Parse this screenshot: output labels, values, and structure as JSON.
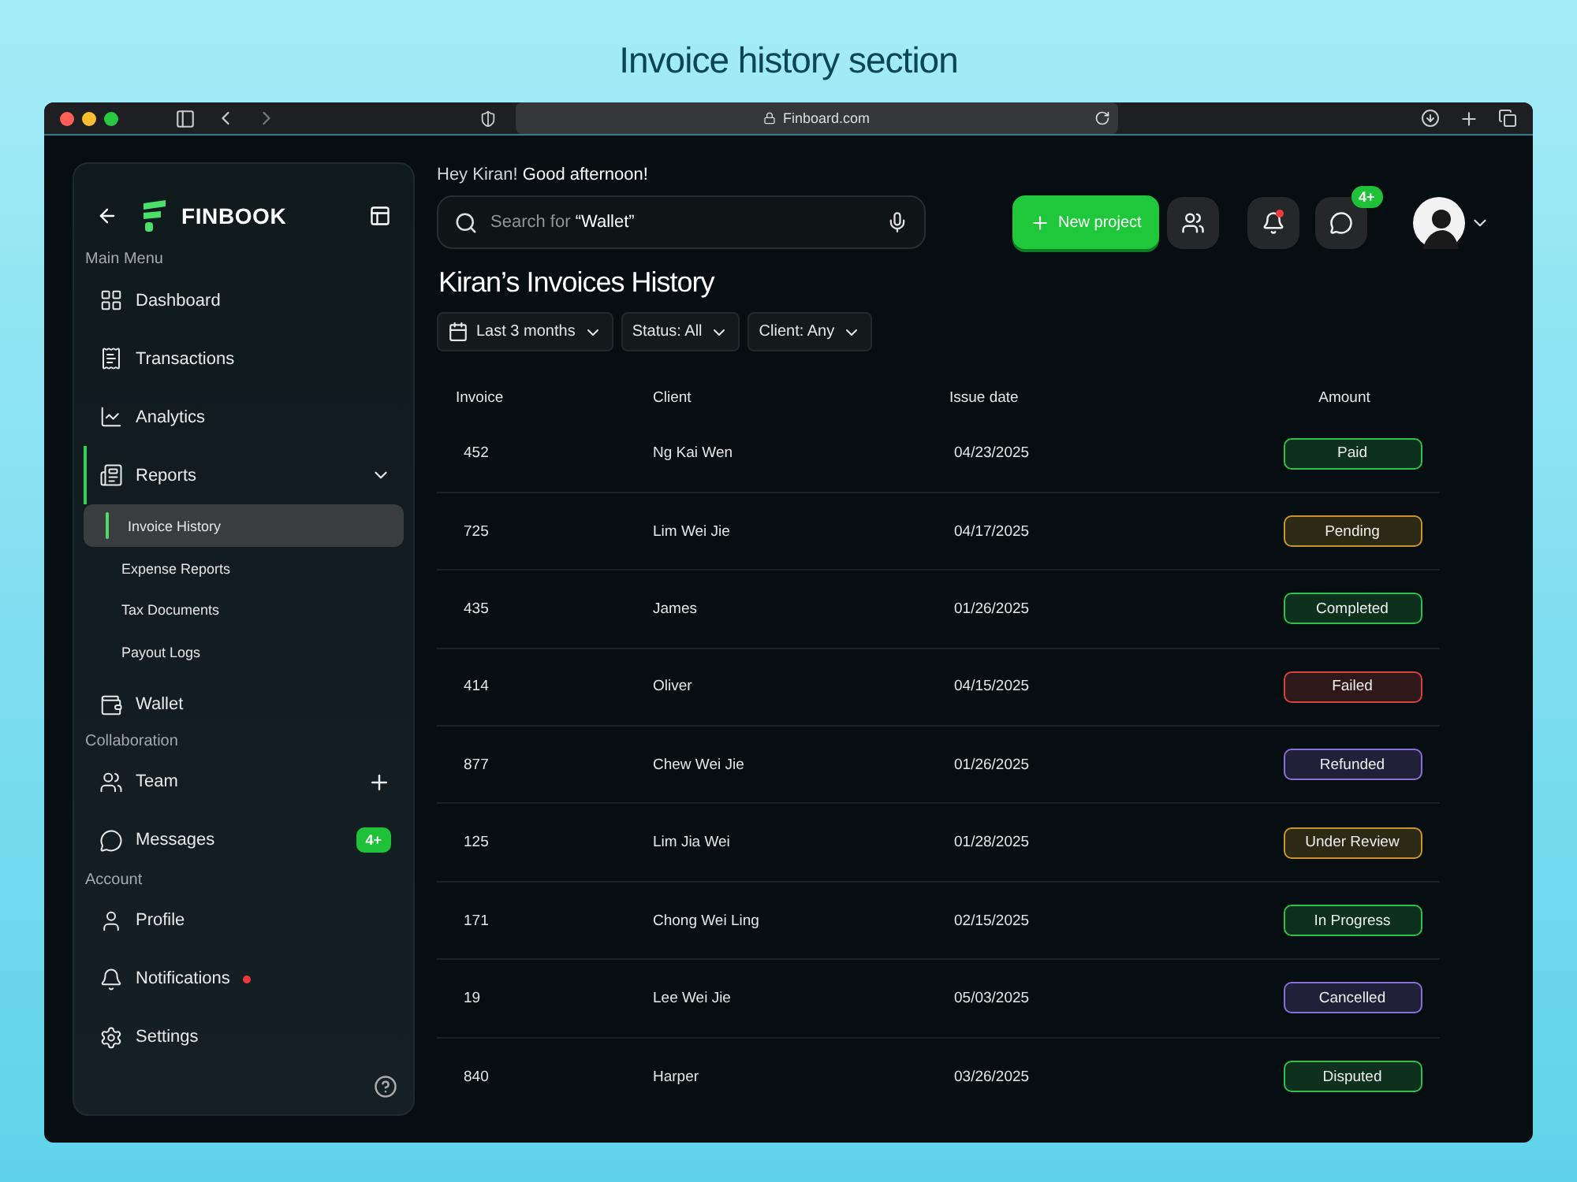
{
  "page_title": "Invoice history section",
  "browser": {
    "url": "Finboard.com"
  },
  "sidebar": {
    "logo": "FINBOOK",
    "sections": [
      {
        "label": "Main Menu",
        "items": [
          {
            "label": "Dashboard",
            "kind": "link",
            "selected": false
          },
          {
            "label": "Transactions",
            "kind": "link",
            "selected": false
          },
          {
            "label": "Analytics",
            "kind": "link",
            "selected": false
          },
          {
            "label": "Reports",
            "kind": "group",
            "selected": true,
            "expanded": true,
            "children": [
              {
                "label": "Invoice History",
                "selected": true
              },
              {
                "label": "Expense Reports",
                "selected": false
              },
              {
                "label": "Tax Documents",
                "selected": false
              },
              {
                "label": "Payout Logs",
                "selected": false
              }
            ]
          },
          {
            "label": "Wallet",
            "kind": "link",
            "selected": false
          }
        ]
      },
      {
        "label": "Collaboration",
        "items": [
          {
            "label": "Team",
            "kind": "add",
            "selected": false
          },
          {
            "label": "Messages",
            "kind": "badge",
            "badge": "4+",
            "selected": false
          }
        ]
      },
      {
        "label": "Account",
        "items": [
          {
            "label": "Profile",
            "kind": "link",
            "selected": false
          },
          {
            "label": "Notifications",
            "kind": "link",
            "alert": true,
            "selected": false
          },
          {
            "label": "Settings",
            "kind": "link",
            "selected": false
          }
        ]
      }
    ]
  },
  "greeting": {
    "prefix": "Hey Kiran!",
    "text": "Good afternoon!"
  },
  "search": {
    "placeholder": "Search for",
    "value": "“Wallet”"
  },
  "new_project": "New project",
  "notifications": {
    "alert": true
  },
  "messages_badge": "4+",
  "heading": "Kiran’s Invoices History",
  "filters": [
    {
      "label": "Last 3 months",
      "kind": "date"
    },
    {
      "label": "Status: All",
      "kind": "plain"
    },
    {
      "label": "Client: Any",
      "kind": "plain"
    }
  ],
  "table": {
    "columns": [
      "Invoice",
      "Client",
      "Issue date",
      "Amount"
    ],
    "rows": [
      {
        "invoice": "452",
        "client": "Ng Kai Wen",
        "date": "04/23/2025",
        "status": "Paid",
        "color": "#2fbf4f"
      },
      {
        "invoice": "725",
        "client": "Lim Wei Jie",
        "date": "04/17/2025",
        "status": "Pending",
        "color": "#c9962a"
      },
      {
        "invoice": "435",
        "client": "James",
        "date": "01/26/2025",
        "status": "Completed",
        "color": "#2fbf4f"
      },
      {
        "invoice": "414",
        "client": "Oliver",
        "date": "04/15/2025",
        "status": "Failed",
        "color": "#d8413f"
      },
      {
        "invoice": "877",
        "client": "Chew Wei Jie",
        "date": "01/26/2025",
        "status": "Refunded",
        "color": "#8a70d6"
      },
      {
        "invoice": "125",
        "client": "Lim Jia Wei",
        "date": "01/28/2025",
        "status": "Under Review",
        "color": "#c9962a"
      },
      {
        "invoice": "171",
        "client": "Chong Wei Ling",
        "date": "02/15/2025",
        "status": "In Progress",
        "color": "#2fbf4f"
      },
      {
        "invoice": "19",
        "client": "Lee Wei Jie",
        "date": "05/03/2025",
        "status": "Cancelled",
        "color": "#8a70d6"
      },
      {
        "invoice": "840",
        "client": "Harper",
        "date": "03/26/2025",
        "status": "Disputed",
        "color": "#2fbf4f"
      }
    ]
  }
}
